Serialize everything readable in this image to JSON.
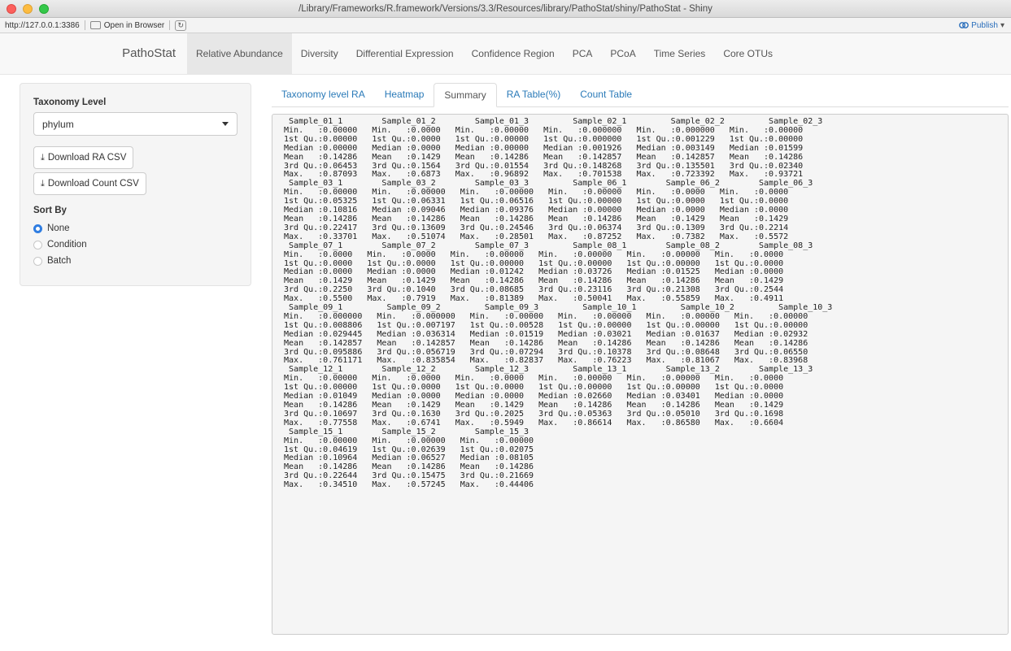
{
  "window": {
    "title": "/Library/Frameworks/R.framework/Versions/3.3/Resources/library/PathoStat/shiny/PathoStat - Shiny"
  },
  "urlbar": {
    "url": "http://127.0.0.1:3386",
    "open_in_browser": "Open in Browser",
    "publish": "Publish"
  },
  "navbar": {
    "brand": "PathoStat",
    "items": [
      {
        "label": "Relative Abundance"
      },
      {
        "label": "Diversity"
      },
      {
        "label": "Differential Expression"
      },
      {
        "label": "Confidence Region"
      },
      {
        "label": "PCA"
      },
      {
        "label": "PCoA"
      },
      {
        "label": "Time Series"
      },
      {
        "label": "Core OTUs"
      }
    ]
  },
  "sidebar": {
    "taxonomy_label": "Taxonomy Level",
    "taxonomy_value": "phylum",
    "download_ra": "Download RA CSV",
    "download_count": "Download Count CSV",
    "sort_by_label": "Sort By",
    "sort_options": [
      {
        "label": "None"
      },
      {
        "label": "Condition"
      },
      {
        "label": "Batch"
      }
    ]
  },
  "tabs": [
    {
      "label": "Taxonomy level RA"
    },
    {
      "label": "Heatmap"
    },
    {
      "label": "Summary"
    },
    {
      "label": "RA Table(%)"
    },
    {
      "label": "Count Table"
    }
  ],
  "summary_text": "  Sample_01_1        Sample_01_2        Sample_01_3         Sample_02_1         Sample_02_2         Sample_02_3\n Min.   :0.00000   Min.   :0.0000   Min.   :0.00000   Min.   :0.000000   Min.   :0.000000   Min.   :0.00000\n 1st Qu.:0.00000   1st Qu.:0.0000   1st Qu.:0.00000   1st Qu.:0.000000   1st Qu.:0.001229   1st Qu.:0.00000\n Median :0.00000   Median :0.0000   Median :0.00000   Median :0.001926   Median :0.003149   Median :0.01599\n Mean   :0.14286   Mean   :0.1429   Mean   :0.14286   Mean   :0.142857   Mean   :0.142857   Mean   :0.14286\n 3rd Qu.:0.06453   3rd Qu.:0.1564   3rd Qu.:0.01554   3rd Qu.:0.148268   3rd Qu.:0.135501   3rd Qu.:0.02340\n Max.   :0.87093   Max.   :0.6873   Max.   :0.96892   Max.   :0.701538   Max.   :0.723392   Max.   :0.93721\n  Sample_03_1        Sample_03_2        Sample_03_3         Sample_06_1        Sample_06_2        Sample_06_3\n Min.   :0.00000   Min.   :0.00000   Min.   :0.00000   Min.   :0.00000   Min.   :0.0000   Min.   :0.0000\n 1st Qu.:0.05325   1st Qu.:0.06331   1st Qu.:0.06516   1st Qu.:0.00000   1st Qu.:0.0000   1st Qu.:0.0000\n Median :0.10816   Median :0.09046   Median :0.09376   Median :0.00000   Median :0.0000   Median :0.0000\n Mean   :0.14286   Mean   :0.14286   Mean   :0.14286   Mean   :0.14286   Mean   :0.1429   Mean   :0.1429\n 3rd Qu.:0.22417   3rd Qu.:0.13609   3rd Qu.:0.24546   3rd Qu.:0.06374   3rd Qu.:0.1309   3rd Qu.:0.2214\n Max.   :0.33701   Max.   :0.51074   Max.   :0.28501   Max.   :0.87252   Max.   :0.7382   Max.   :0.5572\n  Sample_07_1        Sample_07_2        Sample_07_3         Sample_08_1        Sample_08_2        Sample_08_3\n Min.   :0.0000   Min.   :0.0000   Min.   :0.00000   Min.   :0.00000   Min.   :0.00000   Min.   :0.0000\n 1st Qu.:0.0000   1st Qu.:0.0000   1st Qu.:0.00000   1st Qu.:0.00000   1st Qu.:0.00000   1st Qu.:0.0000\n Median :0.0000   Median :0.0000   Median :0.01242   Median :0.03726   Median :0.01525   Median :0.0000\n Mean   :0.1429   Mean   :0.1429   Mean   :0.14286   Mean   :0.14286   Mean   :0.14286   Mean   :0.1429\n 3rd Qu.:0.2250   3rd Qu.:0.1040   3rd Qu.:0.08685   3rd Qu.:0.23116   3rd Qu.:0.21308   3rd Qu.:0.2544\n Max.   :0.5500   Max.   :0.7919   Max.   :0.81389   Max.   :0.50041   Max.   :0.55859   Max.   :0.4911\n  Sample_09_1         Sample_09_2         Sample_09_3         Sample_10_1         Sample_10_2         Sample_10_3\n Min.   :0.000000   Min.   :0.000000   Min.   :0.00000   Min.   :0.00000   Min.   :0.00000   Min.   :0.00000\n 1st Qu.:0.008806   1st Qu.:0.007197   1st Qu.:0.00528   1st Qu.:0.00000   1st Qu.:0.00000   1st Qu.:0.00000\n Median :0.029445   Median :0.036314   Median :0.01519   Median :0.03021   Median :0.01637   Median :0.02932\n Mean   :0.142857   Mean   :0.142857   Mean   :0.14286   Mean   :0.14286   Mean   :0.14286   Mean   :0.14286\n 3rd Qu.:0.095886   3rd Qu.:0.056719   3rd Qu.:0.07294   3rd Qu.:0.10378   3rd Qu.:0.08648   3rd Qu.:0.06550\n Max.   :0.761171   Max.   :0.835854   Max.   :0.82837   Max.   :0.76223   Max.   :0.81067   Max.   :0.83968\n  Sample_12_1        Sample_12_2        Sample_12_3         Sample_13_1        Sample_13_2        Sample_13_3\n Min.   :0.00000   Min.   :0.0000   Min.   :0.0000   Min.   :0.00000   Min.   :0.00000   Min.   :0.0000\n 1st Qu.:0.00000   1st Qu.:0.0000   1st Qu.:0.0000   1st Qu.:0.00000   1st Qu.:0.00000   1st Qu.:0.0000\n Median :0.01049   Median :0.0000   Median :0.0000   Median :0.02660   Median :0.03401   Median :0.0000\n Mean   :0.14286   Mean   :0.1429   Mean   :0.1429   Mean   :0.14286   Mean   :0.14286   Mean   :0.1429\n 3rd Qu.:0.10697   3rd Qu.:0.1630   3rd Qu.:0.2025   3rd Qu.:0.05363   3rd Qu.:0.05010   3rd Qu.:0.1698\n Max.   :0.77558   Max.   :0.6741   Max.   :0.5949   Max.   :0.86614   Max.   :0.86580   Max.   :0.6604\n  Sample_15_1        Sample_15_2        Sample_15_3\n Min.   :0.00000   Min.   :0.00000   Min.   :0.00000\n 1st Qu.:0.04619   1st Qu.:0.02639   1st Qu.:0.02075\n Median :0.10964   Median :0.06527   Median :0.08105\n Mean   :0.14286   Mean   :0.14286   Mean   :0.14286\n 3rd Qu.:0.22644   3rd Qu.:0.15475   3rd Qu.:0.21669\n Max.   :0.34510   Max.   :0.57245   Max.   :0.44406"
}
